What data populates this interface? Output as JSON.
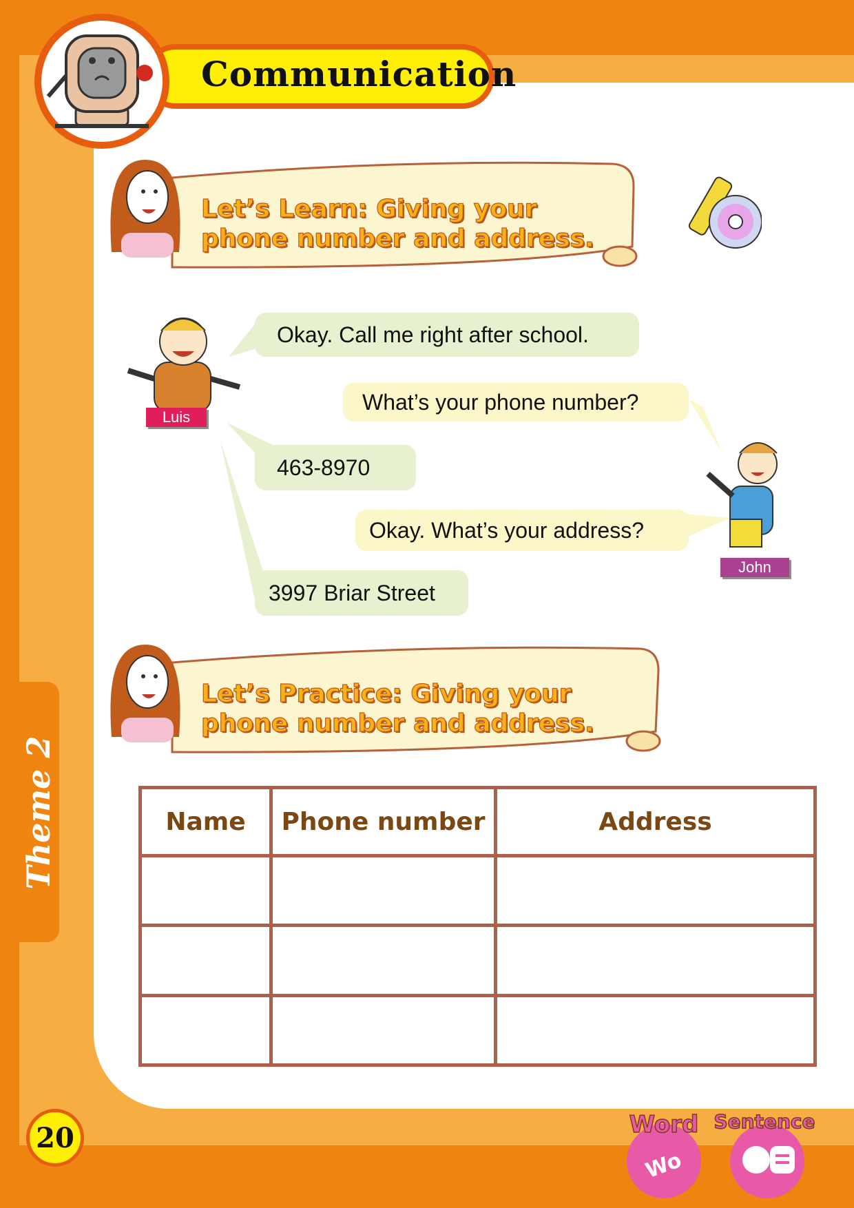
{
  "header": {
    "title": "Communication",
    "mascot_icon": "cartoon-mascot-icon"
  },
  "learn": {
    "banner": "Let’s Learn: Giving your phone number and address.",
    "media_icon": "pen-and-cd-icon"
  },
  "dialogue": {
    "luis_name": "Luis",
    "john_name": "John",
    "lines": [
      "Okay. Call me right after school.",
      "What’s your phone number?",
      "463-8970",
      "Okay. What’s your address?",
      "3997 Briar Street"
    ]
  },
  "practice": {
    "banner": "Let’s Practice: Giving your phone number and address.",
    "table": {
      "headers": [
        "Name",
        "Phone number",
        "Address"
      ],
      "rows": [
        [
          "",
          "",
          ""
        ],
        [
          "",
          "",
          ""
        ],
        [
          "",
          "",
          ""
        ]
      ]
    }
  },
  "sidebar": {
    "theme": "Theme 2"
  },
  "footer": {
    "page_number": "20",
    "word_badge": "Word",
    "sentence_badge": "Sentence"
  },
  "colors": {
    "orange": "#ef8410",
    "light_orange": "#f6ae42",
    "yellow": "#ffee06",
    "pink": "#e85aa8"
  }
}
